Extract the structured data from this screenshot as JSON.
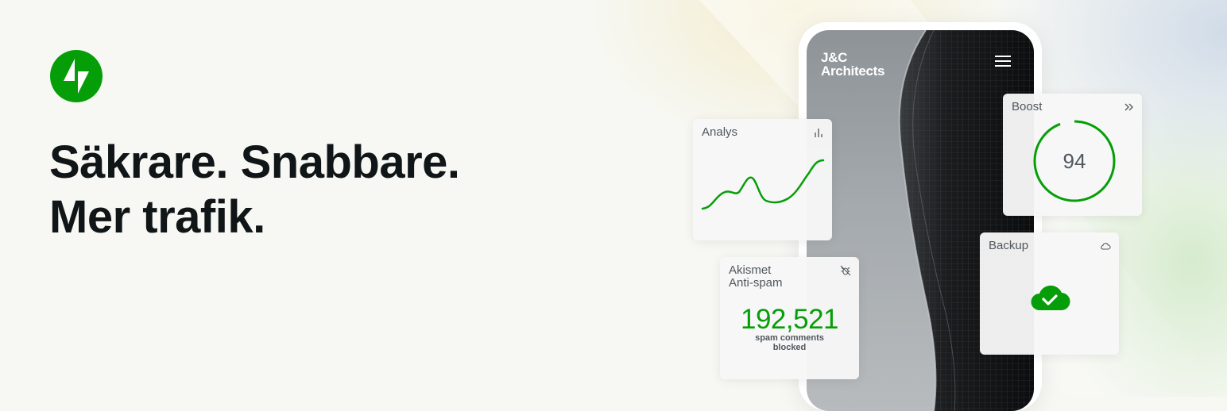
{
  "headline": {
    "line1": "Säkrare. Snabbare.",
    "line2": "Mer trafik."
  },
  "logo": {
    "icon": "jetpack-bolt-icon",
    "color": "#069e08"
  },
  "phone": {
    "brand_line1": "J&C",
    "brand_line2": "Architects",
    "menu_icon": "hamburger-menu-icon"
  },
  "cards": {
    "analys": {
      "title": "Analys",
      "icon": "bar-chart-icon"
    },
    "boost": {
      "title": "Boost",
      "score": "94",
      "score_value": 94,
      "icon": "chevrons-right-icon"
    },
    "akismet": {
      "title_line1": "Akismet",
      "title_line2": "Anti-spam",
      "count": "192,521",
      "label_line1": "spam comments",
      "label_line2": "blocked",
      "icon": "bug-off-icon"
    },
    "backup": {
      "title": "Backup",
      "icon": "cloud-icon",
      "status_icon": "cloud-check-icon"
    }
  },
  "colors": {
    "accent": "#069e08",
    "text": "#101517",
    "muted": "#50575e",
    "background": "#f7f8f4"
  }
}
